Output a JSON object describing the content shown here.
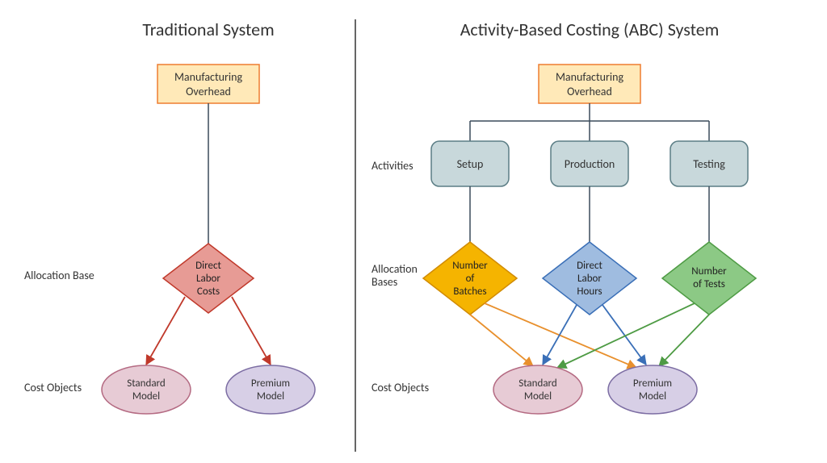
{
  "left": {
    "title": "Traditional System",
    "overhead_box": [
      "Manufacturing",
      "Overhead"
    ],
    "allocation_label": "Allocation Base",
    "allocation_diamond": [
      "Direct",
      "Labor",
      "Costs"
    ],
    "objects_label": "Cost Objects",
    "objects": [
      "Standard\nModel",
      "Premium\nModel"
    ]
  },
  "right": {
    "title": "Activity-Based Costing (ABC) System",
    "overhead_box": [
      "Manufacturing",
      "Overhead"
    ],
    "activities_label": "Activities",
    "activities": [
      "Setup",
      "Production",
      "Testing"
    ],
    "allocation_label": "Allocation\nBases",
    "allocations": [
      {
        "lines": [
          "Number",
          "of",
          "Batches"
        ],
        "fill": "#f5b400",
        "stroke": "#d18b00"
      },
      {
        "lines": [
          "Direct",
          "Labor",
          "Hours"
        ],
        "fill": "#9fbce0",
        "stroke": "#3a6fb7"
      },
      {
        "lines": [
          "Number",
          "of Tests"
        ],
        "fill": "#8cc985",
        "stroke": "#4e9b44"
      }
    ],
    "objects_label": "Cost Objects",
    "objects": [
      "Standard\nModel",
      "Premium\nModel"
    ]
  },
  "colors": {
    "arrow_red": "#c0392b",
    "arrow_orange": "#e8902d",
    "arrow_blue": "#3a6fb7",
    "arrow_green": "#4e9b44",
    "ellipse_left1_fill": "#e7cbd5",
    "ellipse_left1_stroke": "#b46a82",
    "ellipse_left2_fill": "#d7cfe6",
    "ellipse_left2_stroke": "#7c6da3",
    "ellipse_right1_fill": "#e7cbd5",
    "ellipse_right1_stroke": "#b46a82",
    "ellipse_right2_fill": "#d7cfe6",
    "ellipse_right2_stroke": "#7c6da3"
  }
}
